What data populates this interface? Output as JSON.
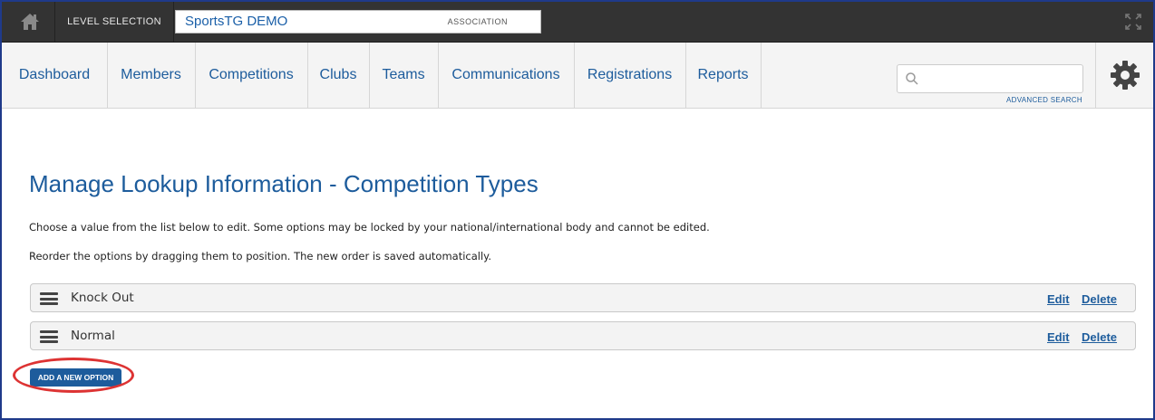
{
  "topbar": {
    "level_selection_label": "LEVEL SELECTION",
    "organisation_name": "SportsTG DEMO",
    "organisation_level": "ASSOCIATION"
  },
  "nav": {
    "items": [
      "Dashboard",
      "Members",
      "Competitions",
      "Clubs",
      "Teams",
      "Communications",
      "Registrations",
      "Reports"
    ],
    "search_placeholder": "",
    "advanced_search_label": "ADVANCED SEARCH"
  },
  "page": {
    "title": "Manage Lookup Information - Competition Types",
    "instruction_1": "Choose a value from the list below to edit. Some options may be locked by your national/international body and cannot be edited.",
    "instruction_2": "Reorder the options by dragging them to position. The new order is saved automatically.",
    "options": [
      {
        "label": "Knock Out",
        "edit": "Edit",
        "delete": "Delete"
      },
      {
        "label": "Normal",
        "edit": "Edit",
        "delete": "Delete"
      }
    ],
    "add_button_label": "ADD A NEW OPTION"
  },
  "colors": {
    "topbar": "#333333",
    "link": "#1d5c9c",
    "button": "#1d5c9c",
    "highlight": "#dd3333",
    "frame": "#1f3a8a"
  },
  "icons": [
    "home-icon",
    "expand-icon",
    "search-icon",
    "gear-icon",
    "drag-handle-icon"
  ]
}
